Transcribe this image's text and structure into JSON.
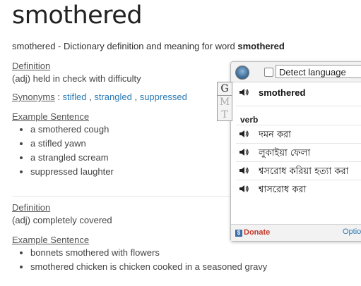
{
  "page": {
    "title": "smothered",
    "subtitle_prefix": "smothered - Dictionary definition and meaning for word ",
    "subtitle_word": "smothered"
  },
  "entry1": {
    "definition_label": "Definition",
    "definition": "(adj) held in check with difficulty",
    "synonyms_label": "Synonyms",
    "synonyms_sep": " : ",
    "synonyms": [
      "stifled",
      "strangled",
      "suppressed"
    ],
    "example_label": "Example Sentence",
    "examples": [
      "a smothered cough",
      "a stifled yawn",
      "a strangled scream",
      "suppressed laughter"
    ]
  },
  "entry2": {
    "definition_label": "Definition",
    "definition": "(adj) completely covered",
    "example_label": "Example Sentence",
    "examples": [
      "bonnets smothered with flowers",
      "smothered chicken is chicken cooked in a seasoned gravy"
    ]
  },
  "translator": {
    "language_select": "Detect language",
    "tabs": [
      "G",
      "M",
      "T"
    ],
    "word": "smothered",
    "part_of_speech": "verb",
    "translations": [
      "দমন করা",
      "লুকাইয়া ফেলা",
      "শ্বসরোধ করিয়া হত্যা করা",
      "শ্বাসরোধ করা"
    ],
    "donate_label": "Donate",
    "options_label": "Optio",
    "speaker_icon": "speaker-icon",
    "accent_color": "#2a7ab5",
    "donate_color": "#c0392b"
  }
}
